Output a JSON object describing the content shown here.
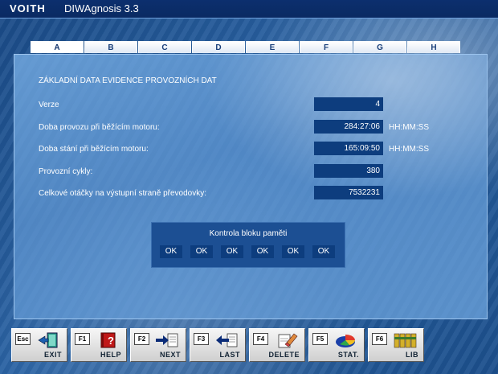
{
  "window": {
    "brand": "VOITH",
    "app_title": "DIWAgnosis 3.3"
  },
  "tabs": [
    "A",
    "B",
    "C",
    "D",
    "E",
    "F",
    "G",
    "H"
  ],
  "active_tab": "A",
  "panel": {
    "title": "ZÁKLADNÍ DATA EVIDENCE PROVOZNÍCH DAT",
    "rows": [
      {
        "label": "Verze",
        "value": "4",
        "unit": ""
      },
      {
        "label": "Doba provozu při běžícím motoru:",
        "value": "284:27:06",
        "unit": "HH:MM:SS"
      },
      {
        "label": "Doba stání při běžícím motoru:",
        "value": "165:09:50",
        "unit": "HH:MM:SS"
      },
      {
        "label": "Provozní cykly:",
        "value": "380",
        "unit": ""
      },
      {
        "label": "Celkové otáčky na výstupní straně převodovky:",
        "value": "7532231",
        "unit": ""
      }
    ]
  },
  "memory_check": {
    "title": "Kontrola bloku paměti",
    "results": [
      "OK",
      "OK",
      "OK",
      "OK",
      "OK",
      "OK"
    ]
  },
  "toolbar": [
    {
      "key": "Esc",
      "label": "EXIT",
      "icon": "exit-door-icon"
    },
    {
      "key": "F1",
      "label": "HELP",
      "icon": "help-book-icon"
    },
    {
      "key": "F2",
      "label": "NEXT",
      "icon": "next-arrow-icon"
    },
    {
      "key": "F3",
      "label": "LAST",
      "icon": "last-arrow-icon"
    },
    {
      "key": "F4",
      "label": "DELETE",
      "icon": "delete-eraser-icon"
    },
    {
      "key": "F5",
      "label": "STAT.",
      "icon": "pie-chart-icon"
    },
    {
      "key": "F6",
      "label": "LIB",
      "icon": "library-books-icon"
    }
  ]
}
